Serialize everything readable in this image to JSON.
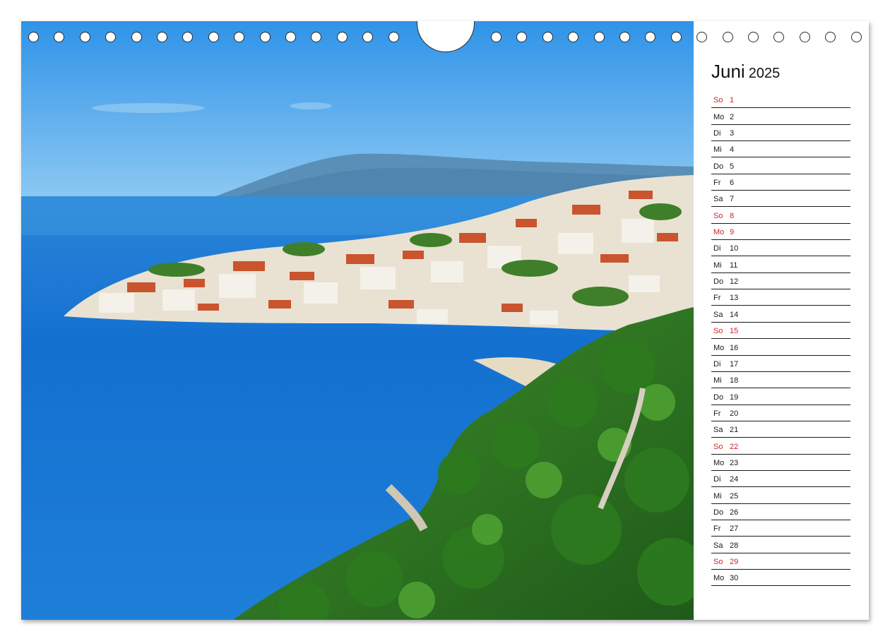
{
  "calendar": {
    "month": "Juni",
    "year": "2025",
    "days": [
      {
        "wd": "So",
        "num": "1",
        "holiday": true
      },
      {
        "wd": "Mo",
        "num": "2",
        "holiday": false
      },
      {
        "wd": "Di",
        "num": "3",
        "holiday": false
      },
      {
        "wd": "Mi",
        "num": "4",
        "holiday": false
      },
      {
        "wd": "Do",
        "num": "5",
        "holiday": false
      },
      {
        "wd": "Fr",
        "num": "6",
        "holiday": false
      },
      {
        "wd": "Sa",
        "num": "7",
        "holiday": false
      },
      {
        "wd": "So",
        "num": "8",
        "holiday": true
      },
      {
        "wd": "Mo",
        "num": "9",
        "holiday": true
      },
      {
        "wd": "Di",
        "num": "10",
        "holiday": false
      },
      {
        "wd": "Mi",
        "num": "11",
        "holiday": false
      },
      {
        "wd": "Do",
        "num": "12",
        "holiday": false
      },
      {
        "wd": "Fr",
        "num": "13",
        "holiday": false
      },
      {
        "wd": "Sa",
        "num": "14",
        "holiday": false
      },
      {
        "wd": "So",
        "num": "15",
        "holiday": true
      },
      {
        "wd": "Mo",
        "num": "16",
        "holiday": false
      },
      {
        "wd": "Di",
        "num": "17",
        "holiday": false
      },
      {
        "wd": "Mi",
        "num": "18",
        "holiday": false
      },
      {
        "wd": "Do",
        "num": "19",
        "holiday": false
      },
      {
        "wd": "Fr",
        "num": "20",
        "holiday": false
      },
      {
        "wd": "Sa",
        "num": "21",
        "holiday": false
      },
      {
        "wd": "So",
        "num": "22",
        "holiday": true
      },
      {
        "wd": "Mo",
        "num": "23",
        "holiday": false
      },
      {
        "wd": "Di",
        "num": "24",
        "holiday": false
      },
      {
        "wd": "Mi",
        "num": "25",
        "holiday": false
      },
      {
        "wd": "Do",
        "num": "26",
        "holiday": false
      },
      {
        "wd": "Fr",
        "num": "27",
        "holiday": false
      },
      {
        "wd": "Sa",
        "num": "28",
        "holiday": false
      },
      {
        "wd": "So",
        "num": "29",
        "holiday": true
      },
      {
        "wd": "Mo",
        "num": "30",
        "holiday": false
      }
    ]
  },
  "colors": {
    "holiday": "#d2232a",
    "text": "#1a1a1a",
    "sky_top": "#3a9be6",
    "sea": "#1f7fd6"
  }
}
